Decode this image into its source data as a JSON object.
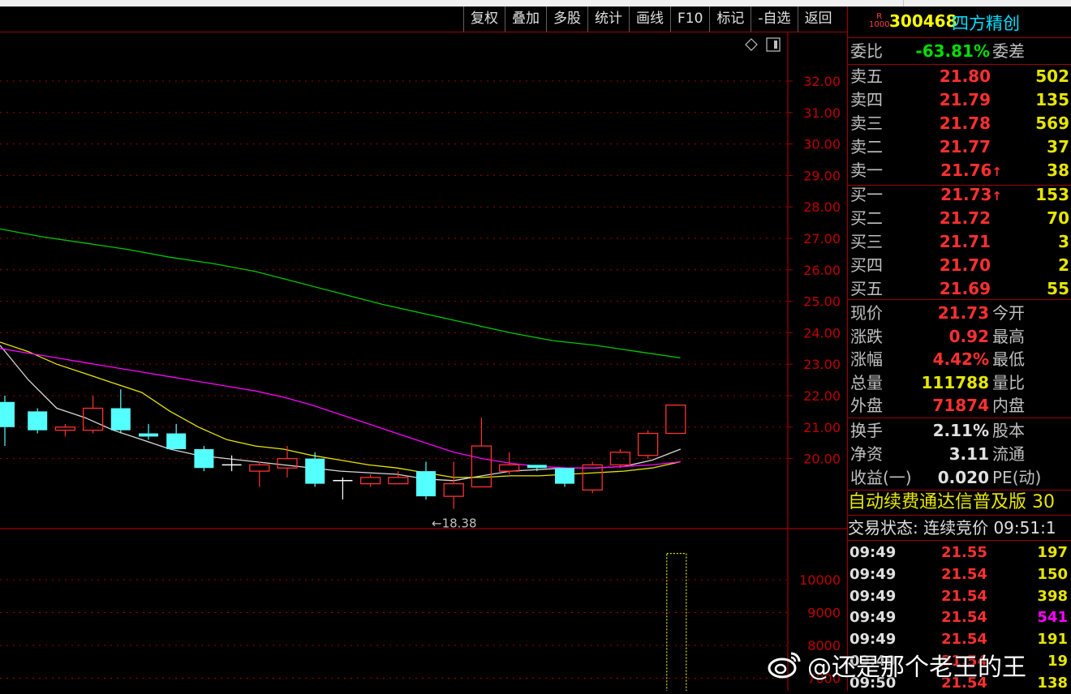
{
  "toolbar": [
    "复权",
    "叠加",
    "多股",
    "统计",
    "画线",
    "F10",
    "标记",
    "-自选",
    "返回"
  ],
  "stock": {
    "badge_top": "R",
    "badge_bottom": "1000",
    "code": "300468",
    "name": "四方精创"
  },
  "weibi": {
    "label": "委比",
    "value": "-63.81%",
    "label2": "委差"
  },
  "asks": [
    {
      "label": "卖五",
      "price": "21.80",
      "vol": "502",
      "arrow": false
    },
    {
      "label": "卖四",
      "price": "21.79",
      "vol": "135",
      "arrow": false
    },
    {
      "label": "卖三",
      "price": "21.78",
      "vol": "569",
      "arrow": false
    },
    {
      "label": "卖二",
      "price": "21.77",
      "vol": "37",
      "arrow": false
    },
    {
      "label": "卖一",
      "price": "21.76",
      "vol": "38",
      "arrow": true
    }
  ],
  "bids": [
    {
      "label": "买一",
      "price": "21.73",
      "vol": "153",
      "arrow": true
    },
    {
      "label": "买二",
      "price": "21.72",
      "vol": "70",
      "arrow": false
    },
    {
      "label": "买三",
      "price": "21.71",
      "vol": "3",
      "arrow": false
    },
    {
      "label": "买四",
      "price": "21.70",
      "vol": "2",
      "arrow": false
    },
    {
      "label": "买五",
      "price": "21.69",
      "vol": "55",
      "arrow": false
    }
  ],
  "stats": [
    {
      "label": "现价",
      "value": "21.73",
      "color": "#ff3030",
      "label2": "今开"
    },
    {
      "label": "涨跌",
      "value": "0.92",
      "color": "#ff3030",
      "label2": "最高"
    },
    {
      "label": "涨幅",
      "value": "4.42%",
      "color": "#ff3030",
      "label2": "最低"
    },
    {
      "label": "总量",
      "value": "111788",
      "color": "#e6e600",
      "label2": "量比"
    },
    {
      "label": "外盘",
      "value": "71874",
      "color": "#ff3030",
      "label2": "内盘"
    }
  ],
  "stats2": [
    {
      "label": "换手",
      "value": "2.11%",
      "label2": "股本"
    },
    {
      "label": "净资",
      "value": "3.11",
      "label2": "流通"
    },
    {
      "label": "收益(一)",
      "value": "0.020",
      "label2": "PE(动)"
    }
  ],
  "notice": "自动续费通达信普及版  30",
  "status": "交易状态: 连续竞价 09:51:1",
  "ticks": [
    {
      "time": "09:49",
      "price": "21.55",
      "vol": "197",
      "color": "#e6e600"
    },
    {
      "time": "09:49",
      "price": "21.54",
      "vol": "150",
      "color": "#e6e600"
    },
    {
      "time": "09:49",
      "price": "21.54",
      "vol": "398",
      "color": "#e6e600"
    },
    {
      "time": "09:49",
      "price": "21.54",
      "vol": "541",
      "color": "#ff00ff"
    },
    {
      "time": "09:49",
      "price": "21.54",
      "vol": "191",
      "color": "#e6e600"
    },
    {
      "time": "09:49",
      "price": "21.54",
      "vol": "19",
      "color": "#e6e600"
    },
    {
      "time": "09:50",
      "price": "21.54",
      "vol": "138",
      "color": "#e6e600"
    }
  ],
  "watermark": "@还是那个老王的王",
  "colors": {
    "up": "#ff3030",
    "down": "#54ffff",
    "ma_white": "#d8d8d8",
    "ma_yellow": "#e6e600",
    "ma_magenta": "#ff00ff",
    "ma_green": "#00c800",
    "grid": "#a00000"
  },
  "chart_data": {
    "type": "candlestick",
    "price_axis": {
      "ticks": [
        "32.00",
        "31.00",
        "30.00",
        "29.00",
        "28.00",
        "27.00",
        "26.00",
        "25.00",
        "24.00",
        "23.00",
        "22.00",
        "21.00",
        "20.00"
      ],
      "range": [
        17.6,
        33.3
      ]
    },
    "volume_axis": {
      "ticks": [
        "10000",
        "9000",
        "8000",
        "7000"
      ]
    },
    "low_annotation": "18.38",
    "candles": [
      {
        "o": 21.8,
        "c": 21.0,
        "h": 22.0,
        "l": 20.4
      },
      {
        "o": 21.5,
        "c": 20.9,
        "h": 21.6,
        "l": 20.8
      },
      {
        "o": 20.9,
        "c": 21.0,
        "h": 21.1,
        "l": 20.7
      },
      {
        "o": 20.9,
        "c": 21.6,
        "h": 22.0,
        "l": 20.8
      },
      {
        "o": 21.6,
        "c": 20.9,
        "h": 22.2,
        "l": 20.8
      },
      {
        "o": 20.8,
        "c": 20.7,
        "h": 21.1,
        "l": 20.6
      },
      {
        "o": 20.8,
        "c": 20.3,
        "h": 21.1,
        "l": 20.3
      },
      {
        "o": 20.3,
        "c": 19.7,
        "h": 20.4,
        "l": 19.6
      },
      {
        "o": 19.8,
        "c": 19.8,
        "h": 20.1,
        "l": 19.6
      },
      {
        "o": 19.6,
        "c": 19.8,
        "h": 19.9,
        "l": 19.1
      },
      {
        "o": 19.7,
        "c": 20.0,
        "h": 20.4,
        "l": 19.4
      },
      {
        "o": 20.0,
        "c": 19.2,
        "h": 20.2,
        "l": 19.1
      },
      {
        "o": 19.3,
        "c": 19.3,
        "h": 19.4,
        "l": 18.7
      },
      {
        "o": 19.2,
        "c": 19.4,
        "h": 19.5,
        "l": 19.1
      },
      {
        "o": 19.2,
        "c": 19.4,
        "h": 19.6,
        "l": 19.2
      },
      {
        "o": 19.6,
        "c": 18.8,
        "h": 19.9,
        "l": 18.7
      },
      {
        "o": 18.8,
        "c": 19.2,
        "h": 19.9,
        "l": 18.4
      },
      {
        "o": 19.1,
        "c": 20.4,
        "h": 21.3,
        "l": 19.1
      },
      {
        "o": 19.6,
        "c": 19.8,
        "h": 20.2,
        "l": 19.5
      },
      {
        "o": 19.8,
        "c": 19.7,
        "h": 19.8,
        "l": 19.6
      },
      {
        "o": 19.7,
        "c": 19.2,
        "h": 19.7,
        "l": 19.1
      },
      {
        "o": 19.0,
        "c": 19.8,
        "h": 19.9,
        "l": 18.9
      },
      {
        "o": 19.8,
        "c": 20.2,
        "h": 20.3,
        "l": 19.7
      },
      {
        "o": 20.1,
        "c": 20.8,
        "h": 20.9,
        "l": 20.0
      },
      {
        "o": 20.8,
        "c": 21.7,
        "h": 21.7,
        "l": 20.8
      }
    ],
    "ma_lines": {
      "white": [
        [
          0,
          23.6
        ],
        [
          1,
          22.5
        ],
        [
          2,
          21.6
        ],
        [
          3,
          21.3
        ],
        [
          4,
          20.9
        ],
        [
          5,
          20.6
        ],
        [
          6,
          20.3
        ],
        [
          7,
          20.1
        ],
        [
          8,
          20.0
        ],
        [
          9,
          19.9
        ],
        [
          10,
          19.8
        ],
        [
          11,
          19.7
        ],
        [
          12,
          19.6
        ],
        [
          13,
          19.55
        ],
        [
          14,
          19.5
        ],
        [
          15,
          19.35
        ],
        [
          16,
          19.3
        ],
        [
          17,
          19.45
        ],
        [
          18,
          19.6
        ],
        [
          19,
          19.65
        ],
        [
          20,
          19.7
        ],
        [
          21,
          19.7
        ],
        [
          22,
          19.75
        ],
        [
          23,
          19.95
        ],
        [
          24,
          20.3
        ]
      ],
      "yellow": [
        [
          0,
          23.7
        ],
        [
          1,
          23.4
        ],
        [
          2,
          23.0
        ],
        [
          3,
          22.7
        ],
        [
          4,
          22.4
        ],
        [
          5,
          22.1
        ],
        [
          6,
          21.5
        ],
        [
          7,
          21.0
        ],
        [
          8,
          20.6
        ],
        [
          9,
          20.4
        ],
        [
          10,
          20.3
        ],
        [
          11,
          20.1
        ],
        [
          12,
          19.95
        ],
        [
          13,
          19.8
        ],
        [
          14,
          19.7
        ],
        [
          15,
          19.55
        ],
        [
          16,
          19.4
        ],
        [
          17,
          19.4
        ],
        [
          18,
          19.45
        ],
        [
          19,
          19.45
        ],
        [
          20,
          19.5
        ],
        [
          21,
          19.55
        ],
        [
          22,
          19.6
        ],
        [
          23,
          19.7
        ],
        [
          24,
          19.9
        ]
      ],
      "magenta": [
        [
          0,
          23.5
        ],
        [
          1,
          23.35
        ],
        [
          2,
          23.2
        ],
        [
          3,
          23.05
        ],
        [
          4,
          22.9
        ],
        [
          5,
          22.75
        ],
        [
          6,
          22.6
        ],
        [
          7,
          22.45
        ],
        [
          8,
          22.3
        ],
        [
          9,
          22.15
        ],
        [
          10,
          21.95
        ],
        [
          11,
          21.7
        ],
        [
          12,
          21.4
        ],
        [
          13,
          21.1
        ],
        [
          14,
          20.8
        ],
        [
          15,
          20.5
        ],
        [
          16,
          20.2
        ],
        [
          17,
          20.0
        ],
        [
          18,
          19.85
        ],
        [
          19,
          19.75
        ],
        [
          20,
          19.7
        ],
        [
          21,
          19.7
        ],
        [
          22,
          19.75
        ],
        [
          23,
          19.8
        ],
        [
          24,
          19.9
        ]
      ],
      "green": [
        [
          0,
          27.3
        ],
        [
          1,
          27.05
        ],
        [
          2,
          26.85
        ],
        [
          3,
          26.65
        ],
        [
          4,
          26.4
        ],
        [
          5,
          26.2
        ],
        [
          6,
          25.95
        ],
        [
          7,
          25.6
        ],
        [
          8,
          25.25
        ],
        [
          9,
          24.9
        ],
        [
          10,
          24.6
        ],
        [
          11,
          24.3
        ],
        [
          12,
          24.0
        ],
        [
          13,
          23.75
        ],
        [
          14,
          23.6
        ],
        [
          15,
          23.4
        ],
        [
          16,
          23.2
        ]
      ]
    },
    "volume_bar_visible": {
      "x_index": 24,
      "value": 10800
    }
  }
}
